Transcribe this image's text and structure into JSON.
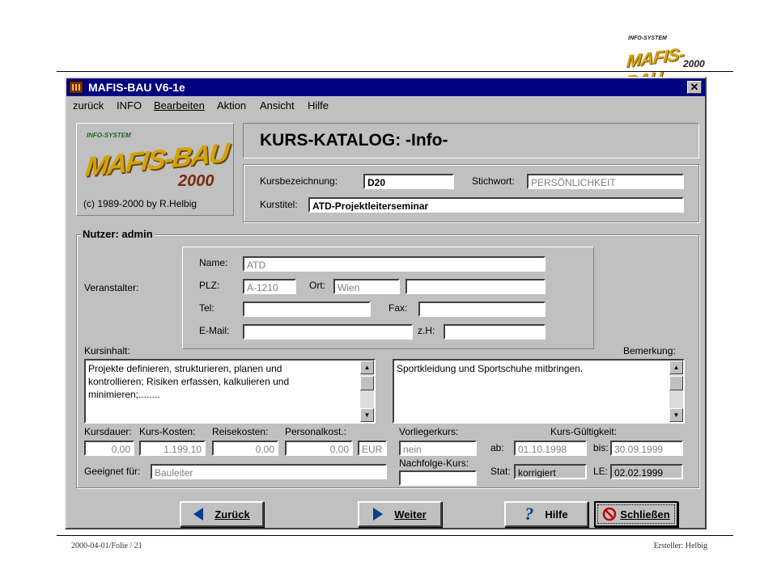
{
  "slide": {
    "footer_left": "2000-04-01/Folie / 21",
    "footer_right": "Ersteller: Helbig",
    "logo": {
      "system": "INFO-SYSTEM",
      "brand": "MAFIS-BAU",
      "year": "2000"
    }
  },
  "window": {
    "title": "MAFIS-BAU V6-1e",
    "close_glyph": "✕",
    "menu": [
      "zurück",
      "INFO",
      "Bearbeiten",
      "Aktion",
      "Ansicht",
      "Hilfe"
    ]
  },
  "logo_panel": {
    "system": "INFO-SYSTEM",
    "brand": "MAFIS-BAU",
    "year": "2000",
    "copyright": "(c) 1989-2000 by R.Helbig"
  },
  "header": {
    "title": "KURS-KATALOG: -Info-",
    "kursbezeichnung_label": "Kursbezeichnung:",
    "kursbezeichnung_value": "D20",
    "stichwort_label": "Stichwort:",
    "stichwort_value": "PERSÖNLICHKEIT",
    "kurstitel_label": "Kurstitel:",
    "kurstitel_value": "ATD-Projektleiterseminar"
  },
  "nutzer": {
    "group_label": "Nutzer: admin",
    "veranstalter_label": "Veranstalter:",
    "name_label": "Name:",
    "name_value": "ATD",
    "plz_label": "PLZ:",
    "plz_value": "A-1210",
    "ort_label": "Ort:",
    "ort_value": "Wien",
    "street_value": "",
    "tel_label": "Tel:",
    "tel_value": "",
    "fax_label": "Fax:",
    "fax_value": "",
    "email_label": "E-Mail:",
    "email_value": "",
    "zh_label": "z.H:",
    "zh_value": ""
  },
  "content": {
    "kursinhalt_label": "Kursinhalt:",
    "kursinhalt_lines": [
      "Projekte definieren, strukturieren, planen und",
      "kontrollieren; Risiken erfassen, kalkulieren und",
      "minimieren;........"
    ],
    "bemerkung_label": "Bemerkung:",
    "bemerkung_text": "Sportkleidung und Sportschuhe mitbringen."
  },
  "costs": {
    "kursdauer_label": "Kursdauer:",
    "kursdauer_value": "0,00",
    "kurskosten_label": "Kurs-Kosten:",
    "kurskosten_value": "1.199,10",
    "reisekosten_label": "Reisekosten:",
    "reisekosten_value": "0,00",
    "personalkost_label": "Personalkost.:",
    "personalkost_value": "0,00",
    "currency_value": "EUR",
    "geeignet_label": "Geeignet für:",
    "geeignet_value": "Bauleiter"
  },
  "status": {
    "vorlieger_label": "Vorliegerkurs:",
    "vorlieger_value": "nein",
    "nachfolge_label": "Nachfolge-Kurs:",
    "nachfolge_value": "",
    "gueltigkeit_label": "Kurs-Gültigkeit:",
    "ab_label": "ab:",
    "ab_value": "01.10.1998",
    "bis_label": "bis:",
    "bis_value": "30.09.1999",
    "stat_label": "Stat:",
    "stat_value": "korrigiert",
    "le_label": "LE:",
    "le_value": "02.02.1999"
  },
  "buttons": {
    "zurueck": "Zurück",
    "weiter": "Weiter",
    "hilfe": "Hilfe",
    "schliessen": "Schließen"
  },
  "colors": {
    "titlebar": "#000080",
    "window_bg": "#c0c0c0",
    "logo_gold": "#d6a20a",
    "arrow_blue": "#0a3d91",
    "stop_red": "#c00000"
  }
}
